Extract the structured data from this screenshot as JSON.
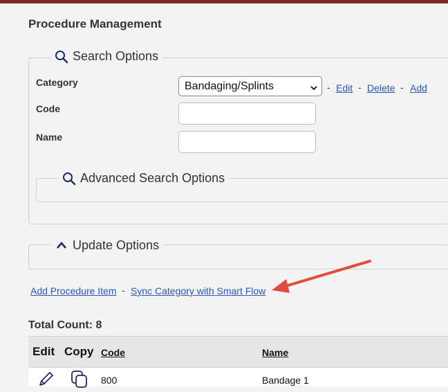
{
  "page": {
    "title": "Procedure Management"
  },
  "search_options": {
    "legend": "Search Options",
    "category_label": "Category",
    "category_value": "Bandaging/Splints",
    "edit_link": "Edit",
    "delete_link": "Delete",
    "add_link": "Add",
    "separator": "-",
    "code_label": "Code",
    "code_value": "",
    "name_label": "Name",
    "name_value": "",
    "advanced_legend": "Advanced Search Options"
  },
  "update_options": {
    "legend": "Update Options"
  },
  "actions": {
    "add_procedure": "Add Procedure Item",
    "separator": "-",
    "sync_category": "Sync Category with Smart Flow"
  },
  "results": {
    "total_count_label": "Total Count: 8",
    "columns": {
      "edit": "Edit",
      "copy": "Copy",
      "code": "Code",
      "name": "Name"
    },
    "rows": [
      {
        "code": "800",
        "name": "Bandage 1"
      }
    ]
  },
  "colors": {
    "link": "#2a57b5",
    "arrow": "#e24a3b",
    "topbar": "#7a2a22"
  },
  "icons": [
    "search-icon",
    "chevron-up-icon",
    "chevron-down-icon",
    "pencil-icon",
    "copy-icon"
  ]
}
